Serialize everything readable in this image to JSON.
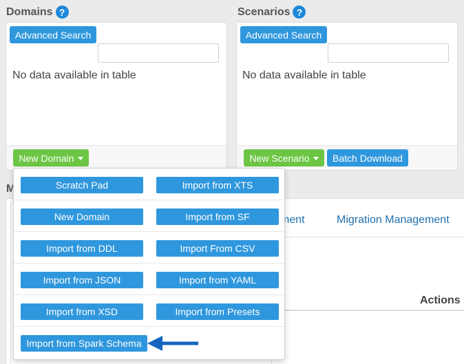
{
  "domains": {
    "title": "Domains",
    "advanced_search": "Advanced Search",
    "empty": "No data available in table",
    "new_button": "New Domain"
  },
  "scenarios": {
    "title": "Scenarios",
    "advanced_search": "Advanced Search",
    "empty": "No data available in table",
    "new_button": "New Scenario",
    "batch_download": "Batch Download"
  },
  "help_glyph": "?",
  "lower": {
    "title_fragment": "M",
    "tab_fragment": "ment",
    "migration_tab": "Migration Management",
    "actions_header": "Actions"
  },
  "dropdown": {
    "items": [
      "Scratch Pad",
      "Import from XTS",
      "New Domain",
      "Import from SF",
      "Import from DDL",
      "Import From CSV",
      "Import from JSON",
      "Import from YAML",
      "Import from XSD",
      "Import from Presets",
      "Import from Spark Schema"
    ]
  },
  "colors": {
    "primary_blue": "#2f97dd",
    "success_green": "#6cc644",
    "arrow_blue": "#1565c0"
  }
}
